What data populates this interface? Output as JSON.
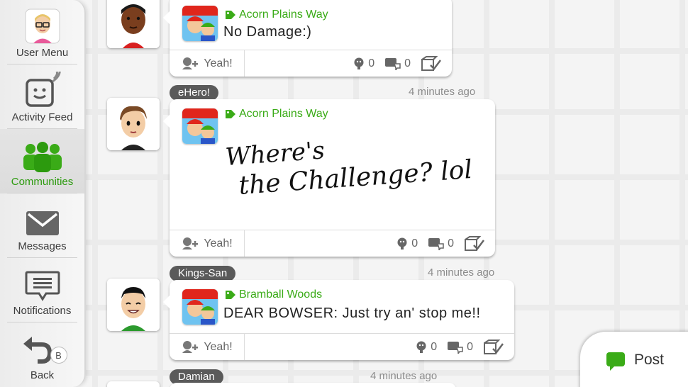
{
  "sidebar": {
    "items": [
      {
        "label": "User Menu"
      },
      {
        "label": "Activity Feed"
      },
      {
        "label": "Communities"
      },
      {
        "label": "Messages"
      },
      {
        "label": "Notifications"
      },
      {
        "label": "Back"
      }
    ],
    "back_key": "B",
    "active_color": "#2c9a0e"
  },
  "posts": [
    {
      "community": "Acorn Plains Way",
      "text": "No Damage:)",
      "yeah_label": "Yeah!",
      "empathy_count": "0",
      "reply_count": "0"
    },
    {
      "user": "eHero!",
      "time": "4 minutes ago",
      "community": "Acorn Plains Way",
      "handwriting_line1": "Where's",
      "handwriting_line2": "the Challenge? lol",
      "yeah_label": "Yeah!",
      "empathy_count": "0",
      "reply_count": "0"
    },
    {
      "user": "Kings-San",
      "time": "4 minutes ago",
      "community": "Bramball Woods",
      "text": "DEAR BOWSER: Just try an' stop me!!",
      "yeah_label": "Yeah!",
      "empathy_count": "0",
      "reply_count": "0"
    },
    {
      "user": "Damian",
      "time": "4 minutes ago"
    }
  ],
  "post_button": {
    "label": "Post"
  },
  "colors": {
    "community_green": "#3aab17",
    "name_tag": "#5a5a5a"
  }
}
